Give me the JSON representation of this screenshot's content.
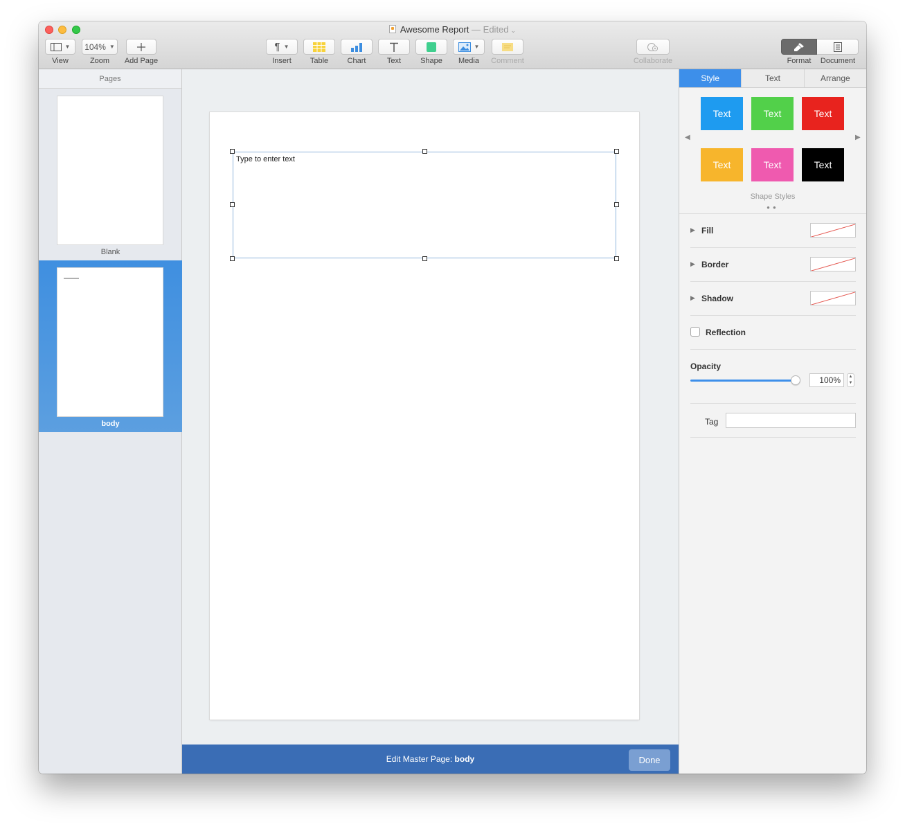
{
  "window": {
    "title": "Awesome Report",
    "title_separator": "—",
    "status": "Edited"
  },
  "toolbar": {
    "view_label": "View",
    "zoom_value": "104%",
    "zoom_label": "Zoom",
    "add_page_label": "Add Page",
    "insert_label": "Insert",
    "table_label": "Table",
    "chart_label": "Chart",
    "text_label": "Text",
    "shape_label": "Shape",
    "media_label": "Media",
    "comment_label": "Comment",
    "collaborate_label": "Collaborate",
    "format_label": "Format",
    "document_label": "Document"
  },
  "sidebar": {
    "header": "Pages",
    "pages": [
      {
        "label": "Blank",
        "selected": false
      },
      {
        "label": "body",
        "selected": true
      }
    ]
  },
  "canvas": {
    "textbox_placeholder": "Type to enter text"
  },
  "master_bar": {
    "prefix": "Edit Master Page:",
    "page_name": "body",
    "done_label": "Done"
  },
  "inspector": {
    "tabs": [
      {
        "label": "Style",
        "active": true
      },
      {
        "label": "Text",
        "active": false
      },
      {
        "label": "Arrange",
        "active": false
      }
    ],
    "swatches": [
      {
        "label": "Text",
        "color": "#1e9bf0"
      },
      {
        "label": "Text",
        "color": "#52d04a"
      },
      {
        "label": "Text",
        "color": "#e8231e"
      },
      {
        "label": "Text",
        "color": "#f7b52c"
      },
      {
        "label": "Text",
        "color": "#ef5aaf"
      },
      {
        "label": "Text",
        "color": "#000000"
      }
    ],
    "shape_styles_label": "Shape Styles",
    "fill_label": "Fill",
    "border_label": "Border",
    "shadow_label": "Shadow",
    "reflection_label": "Reflection",
    "opacity_label": "Opacity",
    "opacity_value": "100%",
    "opacity_level": 1.0,
    "tag_label": "Tag",
    "tag_value": ""
  }
}
